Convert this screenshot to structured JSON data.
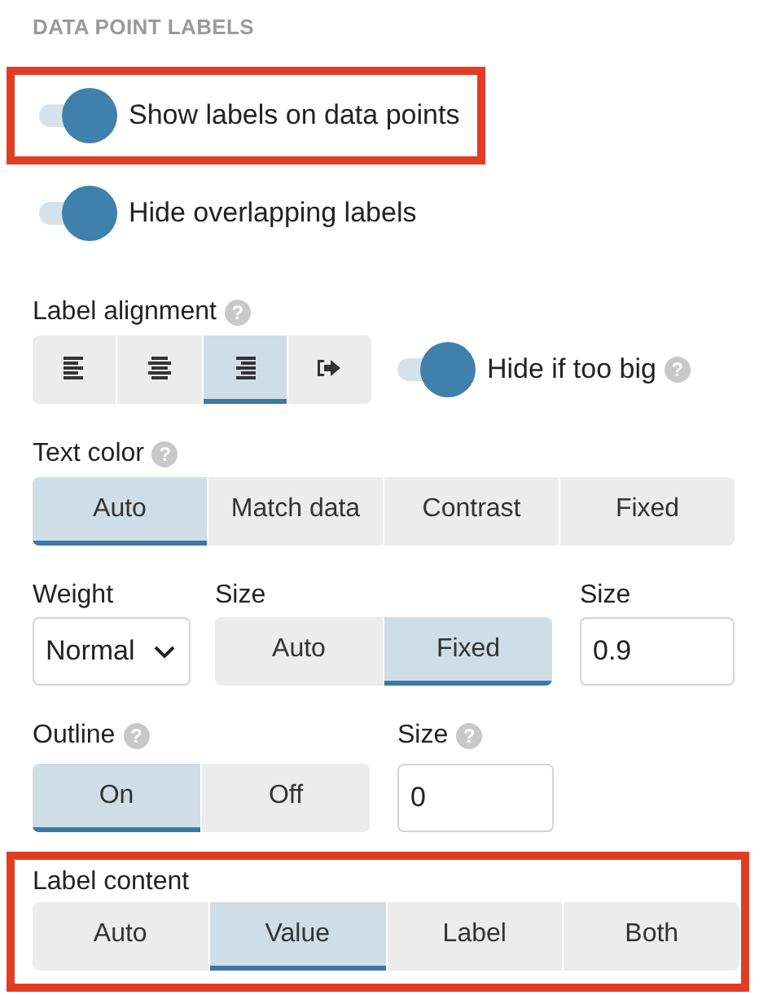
{
  "section_title": "DATA POINT LABELS",
  "toggles": [
    {
      "label": "Show labels on data points",
      "on": true,
      "highlighted": true
    },
    {
      "label": "Hide overlapping labels",
      "on": true,
      "highlighted": false
    }
  ],
  "alignment": {
    "label": "Label alignment",
    "help": "?",
    "options": [
      {
        "kind": "left",
        "selected": false
      },
      {
        "kind": "center",
        "selected": false
      },
      {
        "kind": "right",
        "selected": true
      },
      {
        "kind": "outside",
        "selected": false
      }
    ],
    "toggle": {
      "label": "Hide if too big",
      "on": true,
      "help": "?"
    }
  },
  "text_color": {
    "label": "Text color",
    "help": "?",
    "options": [
      {
        "label": "Auto",
        "selected": true
      },
      {
        "label": "Match data",
        "selected": false
      },
      {
        "label": "Contrast",
        "selected": false
      },
      {
        "label": "Fixed",
        "selected": false
      }
    ]
  },
  "weight": {
    "label": "Weight",
    "value": "Normal"
  },
  "size_mode": {
    "label": "Size",
    "options": [
      {
        "label": "Auto",
        "selected": false
      },
      {
        "label": "Fixed",
        "selected": true
      }
    ]
  },
  "size": {
    "label": "Size",
    "value": "0.9"
  },
  "outline": {
    "label": "Outline",
    "help": "?",
    "options": [
      {
        "label": "On",
        "selected": true
      },
      {
        "label": "Off",
        "selected": false
      }
    ]
  },
  "outline_size": {
    "label": "Size",
    "help": "?",
    "value": "0"
  },
  "label_content": {
    "label": "Label content",
    "highlighted": true,
    "options": [
      {
        "label": "Auto",
        "selected": false
      },
      {
        "label": "Value",
        "selected": true
      },
      {
        "label": "Label",
        "selected": false
      },
      {
        "label": "Both",
        "selected": false
      }
    ]
  }
}
